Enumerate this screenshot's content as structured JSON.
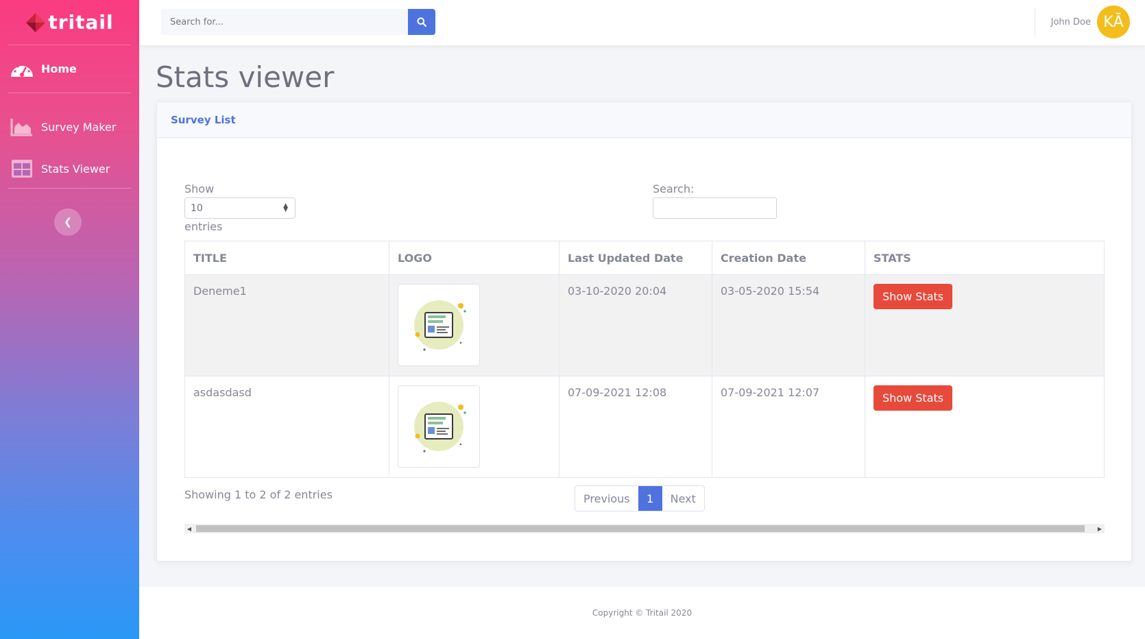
{
  "brand": {
    "name": "tritail"
  },
  "sidebar": {
    "items": [
      {
        "label": "Home",
        "icon": "tachometer-icon"
      },
      {
        "label": "Survey Maker",
        "icon": "area-chart-icon"
      },
      {
        "label": "Stats Viewer",
        "icon": "table-grid-icon"
      }
    ],
    "toggle_icon": "chevron-left-icon"
  },
  "topbar": {
    "search_placeholder": "Search for...",
    "user_name": "John Doe",
    "avatar_initials": "KĀ",
    "avatar_color": "#f3bd1b"
  },
  "page": {
    "title": "Stats viewer"
  },
  "card": {
    "header": "Survey List",
    "show_label": "Show",
    "entries_value": "10",
    "entries_label": "entries",
    "search_label": "Search:",
    "columns": [
      "TITLE",
      "LOGO",
      "Last Updated Date",
      "Creation Date",
      "STATS"
    ],
    "rows": [
      {
        "title": "Deneme1",
        "updated": "03-10-2020 20:04",
        "created": "03-05-2020 15:54",
        "action": "Show Stats"
      },
      {
        "title": "asdasdasd",
        "updated": "07-09-2021 12:08",
        "created": "07-09-2021 12:07",
        "action": "Show Stats"
      }
    ],
    "info": "Showing 1 to 2 of 2 entries",
    "pager": {
      "previous": "Previous",
      "current": "1",
      "next": "Next"
    }
  },
  "footer": {
    "text": "Copyright © Tritail 2020"
  },
  "colors": {
    "primary": "#4e73df",
    "danger": "#e74a3b",
    "sidebar_top": "#fb3b80",
    "sidebar_bottom": "#2a98f7"
  }
}
